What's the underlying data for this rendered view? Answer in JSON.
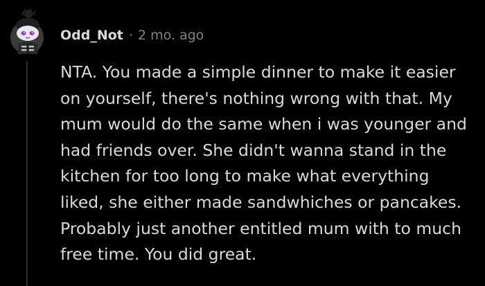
{
  "comment": {
    "author": "Odd_Not",
    "separator": "·",
    "timestamp": "2 mo. ago",
    "avatar_icon": "snoo-avatar-icon",
    "body": "NTA. You made a simple dinner to make it easier on yourself, there's nothing wrong with that. My mum would do the same when i was younger and had friends over. She didn't wanna stand in the kitchen for too long to make what everything liked, she either made sandwhiches or pancakes. Probably just another entitled mum with to much free time. You did great."
  },
  "colors": {
    "background": "#000000",
    "text": "#d7dadc",
    "meta": "#818384",
    "thread_line": "#2b2b2b",
    "avatar_bg": "#3a3a3a"
  }
}
